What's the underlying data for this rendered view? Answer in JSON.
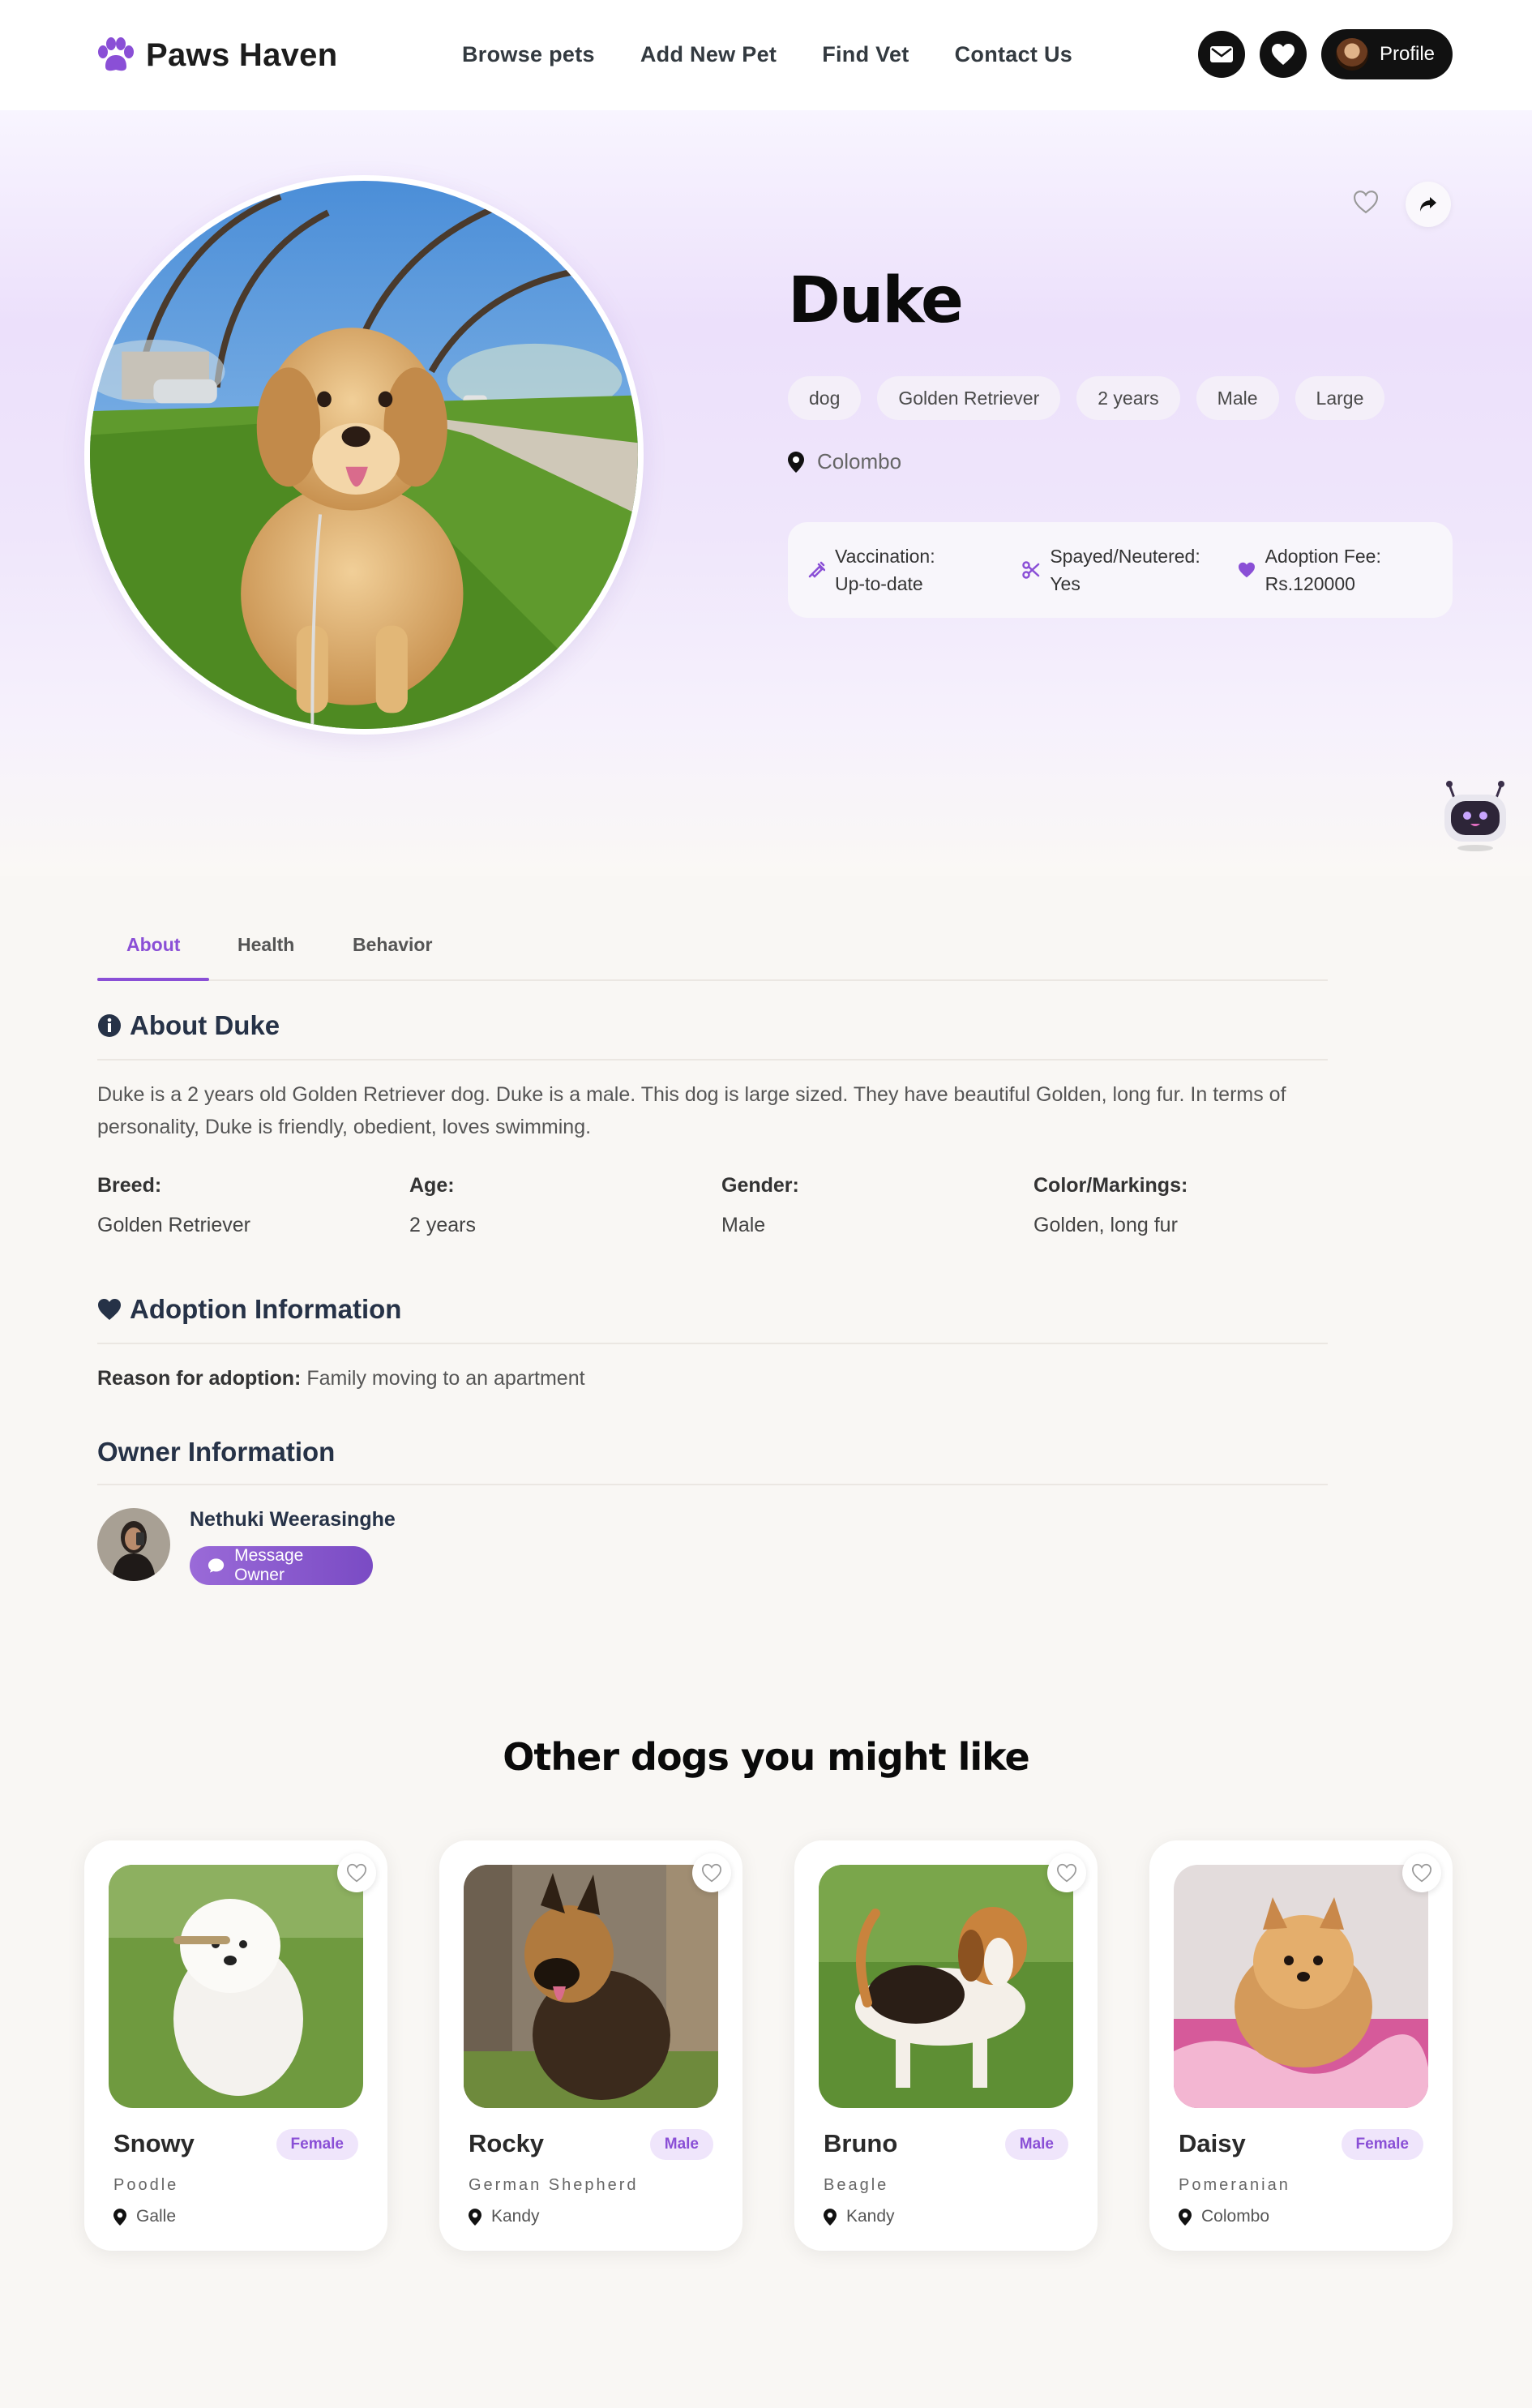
{
  "header": {
    "brand": "Paws Haven",
    "nav": [
      "Browse pets",
      "Add New Pet",
      "Find Vet",
      "Contact Us"
    ],
    "profile_label": "Profile",
    "icons": [
      "paw-icon",
      "mail-icon",
      "heart-icon"
    ]
  },
  "pet": {
    "name": "Duke",
    "tags": [
      "dog",
      "Golden Retriever",
      "2 years",
      "Male",
      "Large"
    ],
    "location": "Colombo",
    "info": [
      {
        "label": "Vaccination:",
        "value": "Up-to-date",
        "icon": "syringe-icon"
      },
      {
        "label": "Spayed/Neutered:",
        "value": "Yes",
        "icon": "scissors-icon"
      },
      {
        "label": "Adoption Fee:",
        "value": "Rs.120000",
        "icon": "heart-icon"
      }
    ]
  },
  "tabs": [
    "About",
    "Health",
    "Behavior"
  ],
  "about": {
    "title": "About Duke",
    "text": "Duke is a 2 years old Golden Retriever dog. Duke is a male. This dog is large sized. They have beautiful Golden, long fur. In terms of personality, Duke is friendly, obedient, loves swimming.",
    "facts": [
      {
        "k": "Breed:",
        "v": "Golden Retriever"
      },
      {
        "k": "Age:",
        "v": "2 years"
      },
      {
        "k": "Gender:",
        "v": "Male"
      },
      {
        "k": "Color/Markings:",
        "v": "Golden, long fur"
      }
    ]
  },
  "adoption": {
    "title": "Adoption Information",
    "reason_label": "Reason for adoption:",
    "reason": "Family moving to an apartment"
  },
  "owner": {
    "title": "Owner Information",
    "name": "Nethuki Weerasinghe",
    "button": "Message Owner"
  },
  "others": {
    "title": "Other dogs you might like",
    "cards": [
      {
        "name": "Snowy",
        "gender": "Female",
        "breed": "Poodle",
        "location": "Galle"
      },
      {
        "name": "Rocky",
        "gender": "Male",
        "breed": "German Shepherd",
        "location": "Kandy"
      },
      {
        "name": "Bruno",
        "gender": "Male",
        "breed": "Beagle",
        "location": "Kandy"
      },
      {
        "name": "Daisy",
        "gender": "Female",
        "breed": "Pomeranian",
        "location": "Colombo"
      }
    ]
  },
  "colors": {
    "accent": "#8a4fd6",
    "dark": "#111111",
    "hero_bg": "#ece0fb"
  }
}
